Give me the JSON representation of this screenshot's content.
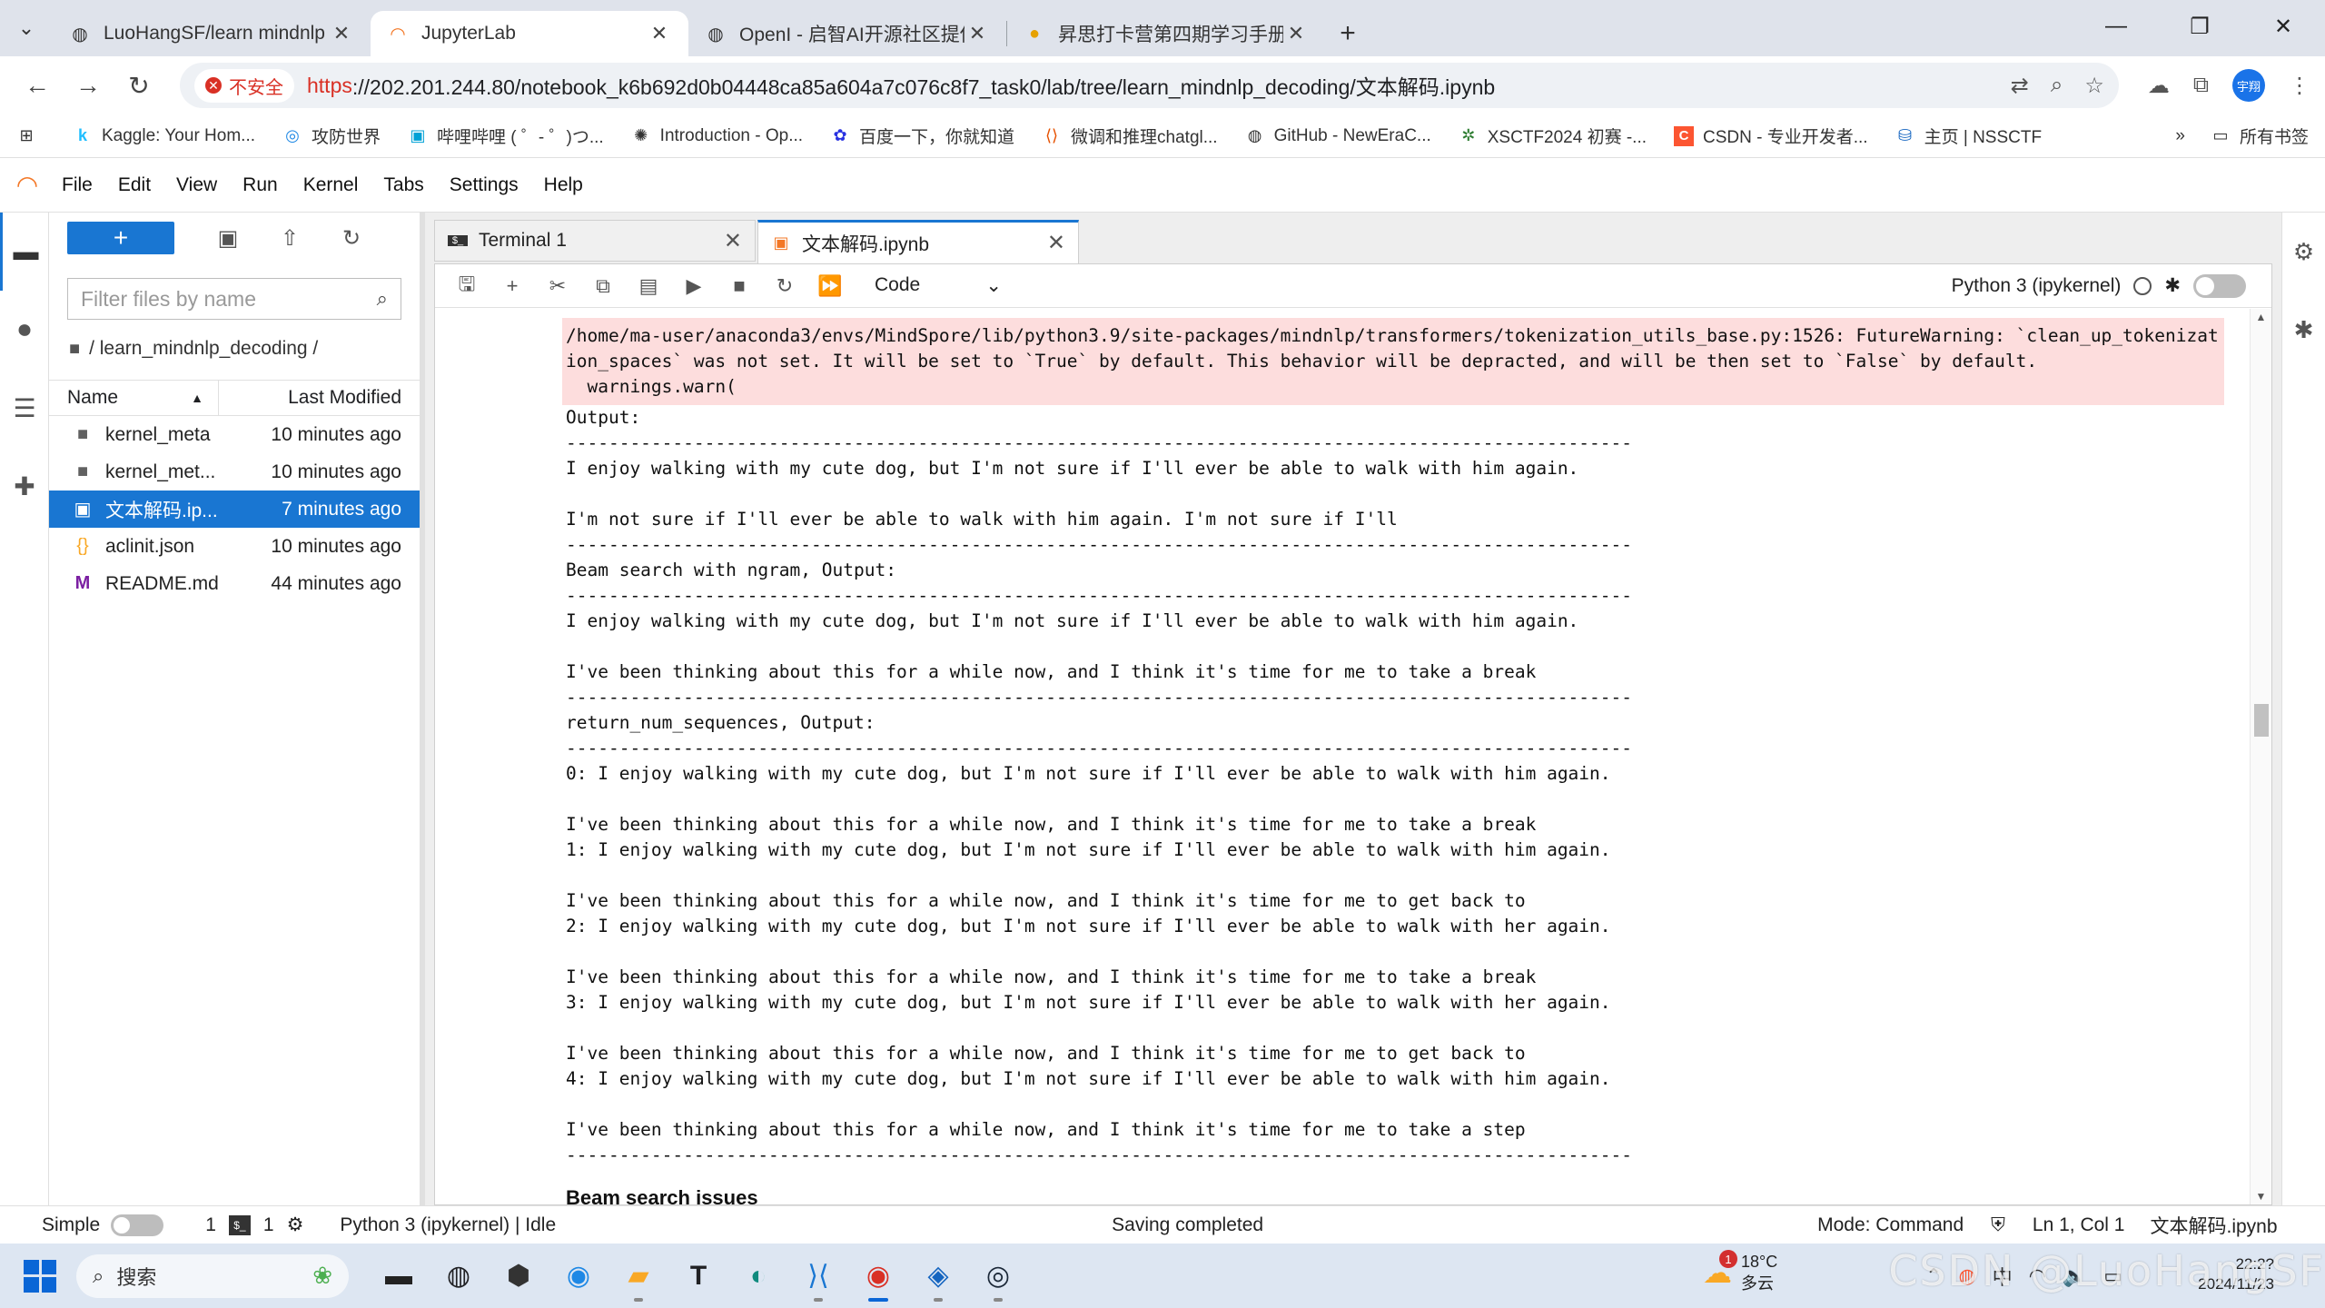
{
  "browser": {
    "tabs": [
      {
        "title": "LuoHangSF/learn mindnlp d",
        "icon": "github-icon",
        "active": false
      },
      {
        "title": "JupyterLab",
        "icon": "jupyter-icon",
        "active": true
      },
      {
        "title": "OpenI - 启智AI开源社区提供普",
        "icon": "openi-icon",
        "active": false
      },
      {
        "title": "昇思打卡营第四期学习手册（庄",
        "icon": "mindspore-icon",
        "active": false
      }
    ],
    "insecure_label": "不安全",
    "url_scheme": "https",
    "url_rest": "://202.201.244.80/notebook_k6b692d0b04448ca85a604a7c076c8f7_task0/lab/tree/learn_mindnlp_decoding/文本解码.ipynb",
    "profile_label": "宇翔",
    "bookmarks": [
      {
        "label": "Kaggle: Your Hom...",
        "icon": "kaggle-icon"
      },
      {
        "label": "攻防世界",
        "icon": "adworld-icon"
      },
      {
        "label": "哔哩哔哩 ( ゜- ゜)つ...",
        "icon": "bilibili-icon"
      },
      {
        "label": "Introduction - Op...",
        "icon": "openai-icon"
      },
      {
        "label": "百度一下，你就知道",
        "icon": "baidu-icon"
      },
      {
        "label": "微调和推理chatgl...",
        "icon": "bracket-icon"
      },
      {
        "label": "GitHub - NewEraC...",
        "icon": "github-icon"
      },
      {
        "label": "XSCTF2024 初赛 -...",
        "icon": "xsctf-icon"
      },
      {
        "label": "CSDN - 专业开发者...",
        "icon": "csdn-icon"
      },
      {
        "label": "主页 | NSSCTF",
        "icon": "nssctf-icon"
      }
    ],
    "all_bookmarks": "所有书签"
  },
  "jupyter": {
    "menu": [
      "File",
      "Edit",
      "View",
      "Run",
      "Kernel",
      "Tabs",
      "Settings",
      "Help"
    ],
    "filebrowser": {
      "filter_placeholder": "Filter files by name",
      "breadcrumb": "/ learn_mindnlp_decoding /",
      "col_name": "Name",
      "col_modified": "Last Modified",
      "files": [
        {
          "name": "kernel_meta",
          "modified": "10 minutes ago",
          "icon": "folder-icon",
          "selected": false
        },
        {
          "name": "kernel_met...",
          "modified": "10 minutes ago",
          "icon": "folder-icon",
          "selected": false
        },
        {
          "name": "文本解码.ip...",
          "modified": "7 minutes ago",
          "icon": "notebook-icon",
          "selected": true
        },
        {
          "name": "aclinit.json",
          "modified": "10 minutes ago",
          "icon": "json-icon",
          "selected": false
        },
        {
          "name": "README.md",
          "modified": "44 minutes ago",
          "icon": "markdown-icon",
          "selected": false
        }
      ]
    },
    "doc_tabs": [
      {
        "title": "Terminal 1",
        "icon": "terminal-icon"
      },
      {
        "title": "文本解码.ipynb",
        "icon": "notebook-icon"
      }
    ],
    "cell_type": "Code",
    "kernel_name": "Python 3 (ipykernel)",
    "stderr_text": "/home/ma-user/anaconda3/envs/MindSpore/lib/python3.9/site-packages/mindnlp/transformers/tokenization_utils_base.py:1526: FutureWarning: `clean_up_tokenization_spaces` was not set. It will be set to `True` by default. This behavior will be depracted, and will be then set to `False` by default.\n  warnings.warn(",
    "output_text": "Output:\n----------------------------------------------------------------------------------------------------\nI enjoy walking with my cute dog, but I'm not sure if I'll ever be able to walk with him again.\n\nI'm not sure if I'll ever be able to walk with him again. I'm not sure if I'll\n----------------------------------------------------------------------------------------------------\nBeam search with ngram, Output:\n----------------------------------------------------------------------------------------------------\nI enjoy walking with my cute dog, but I'm not sure if I'll ever be able to walk with him again.\n\nI've been thinking about this for a while now, and I think it's time for me to take a break\n----------------------------------------------------------------------------------------------------\nreturn_num_sequences, Output:\n----------------------------------------------------------------------------------------------------\n0: I enjoy walking with my cute dog, but I'm not sure if I'll ever be able to walk with him again.\n\nI've been thinking about this for a while now, and I think it's time for me to take a break\n1: I enjoy walking with my cute dog, but I'm not sure if I'll ever be able to walk with him again.\n\nI've been thinking about this for a while now, and I think it's time for me to get back to\n2: I enjoy walking with my cute dog, but I'm not sure if I'll ever be able to walk with her again.\n\nI've been thinking about this for a while now, and I think it's time for me to take a break\n3: I enjoy walking with my cute dog, but I'm not sure if I'll ever be able to walk with her again.\n\nI've been thinking about this for a while now, and I think it's time for me to get back to\n4: I enjoy walking with my cute dog, but I'm not sure if I'll ever be able to walk with him again.\n\nI've been thinking about this for a while now, and I think it's time for me to take a step\n----------------------------------------------------------------------------------------------------",
    "markdown_heading": "Beam search issues",
    "status": {
      "mode_label": "Simple",
      "count_a": "1",
      "count_b": "1",
      "kernel_status": "Python 3 (ipykernel) | Idle",
      "message": "Saving completed",
      "mode": "Mode: Command",
      "position": "Ln 1, Col 1",
      "filename": "文本解码.ipynb"
    }
  },
  "taskbar": {
    "search_label": "搜索",
    "weather_temp": "18°C",
    "weather_desc": "多云",
    "weather_badge": "1",
    "time": "22:2?",
    "date": "2024/11/23",
    "tray_lang": "中"
  },
  "watermark": "CSDN @LuoHangSF"
}
